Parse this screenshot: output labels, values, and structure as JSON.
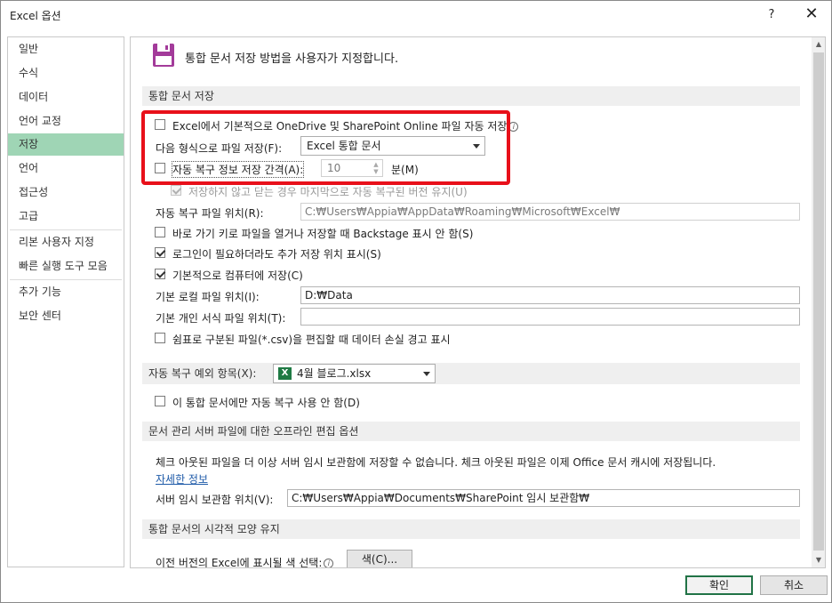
{
  "window": {
    "title": "Excel 옵션",
    "help_label": "?",
    "close_label": "✕"
  },
  "sidebar": {
    "items": [
      {
        "label": "일반"
      },
      {
        "label": "수식"
      },
      {
        "label": "데이터"
      },
      {
        "label": "언어 교정"
      },
      {
        "label": "저장"
      },
      {
        "label": "언어"
      },
      {
        "label": "접근성"
      },
      {
        "label": "고급"
      },
      {
        "label": "리본 사용자 지정"
      },
      {
        "label": "빠른 실행 도구 모음"
      },
      {
        "label": "추가 기능"
      },
      {
        "label": "보안 센터"
      }
    ],
    "active_index": 4
  },
  "header": {
    "description": "통합 문서 저장 방법을 사용자가 지정합니다."
  },
  "save_workbooks": {
    "heading": "통합 문서 저장",
    "autosave_label": "Excel에서 기본적으로 OneDrive 및 SharePoint Online 파일 자동 저장",
    "autosave_checked": false,
    "format_label": "다음 형식으로 파일 저장(F):",
    "format_value": "Excel 통합 문서",
    "autorecover_label": "자동 복구 정보 저장 간격(A):",
    "autorecover_checked": false,
    "autorecover_minutes": "10",
    "minutes_unit": "분(M)",
    "keep_last_label": "저장하지 않고 닫는 경우 마지막으로 자동 복구된 버전 유지(U)",
    "keep_last_checked": true,
    "autorecover_location_label": "자동 복구 파일 위치(R):",
    "autorecover_location_value": "C:₩Users₩Appia₩AppData₩Roaming₩Microsoft₩Excel₩",
    "no_backstage_label": "바로 가기 키로 파일을 열거나 저장할 때 Backstage 표시 안 함(S)",
    "no_backstage_checked": false,
    "show_additional_label": "로그인이 필요하더라도 추가 저장 위치 표시(S)",
    "show_additional_checked": true,
    "save_to_computer_label": "기본적으로 컴퓨터에 저장(C)",
    "save_to_computer_checked": true,
    "default_local_label": "기본 로컬 파일 위치(I):",
    "default_local_value": "D:₩Data",
    "default_template_label": "기본 개인 서식 파일 위치(T):",
    "default_template_value": "",
    "csv_warning_label": "쉼표로 구분된 파일(*.csv)을 편집할 때 데이터 손실 경고 표시",
    "csv_warning_checked": false
  },
  "autorecover_exceptions": {
    "heading": "자동 복구 예외 항목(X):",
    "workbook_value": "4월 블로그.xlsx",
    "excel_icon": "excel-file-icon",
    "disable_label": "이 통합 문서에만 자동 복구 사용 안 함(D)",
    "disable_checked": false
  },
  "offline_editing": {
    "heading": "문서 관리 서버 파일에 대한 오프라인 편집 옵션",
    "description": "체크 아웃된 파일을 더 이상 서버 임시 보관함에 저장할 수 없습니다. 체크 아웃된 파일은 이제 Office 문서 캐시에 저장됩니다.",
    "learn_more": "자세한 정보",
    "drafts_label": "서버 임시 보관함 위치(V):",
    "drafts_value": "C:₩Users₩Appia₩Documents₩SharePoint 임시 보관함₩"
  },
  "visual_appearance": {
    "heading": "통합 문서의 시각적 모양 유지",
    "colors_label": "이전 버전의 Excel에 표시될 색 선택:",
    "colors_button": "색(C)..."
  },
  "footer": {
    "ok_label": "확인",
    "cancel_label": "취소"
  },
  "colors": {
    "accent_green": "#217346",
    "sidebar_active": "#9fd5b5",
    "highlight_red": "#e8101a"
  }
}
